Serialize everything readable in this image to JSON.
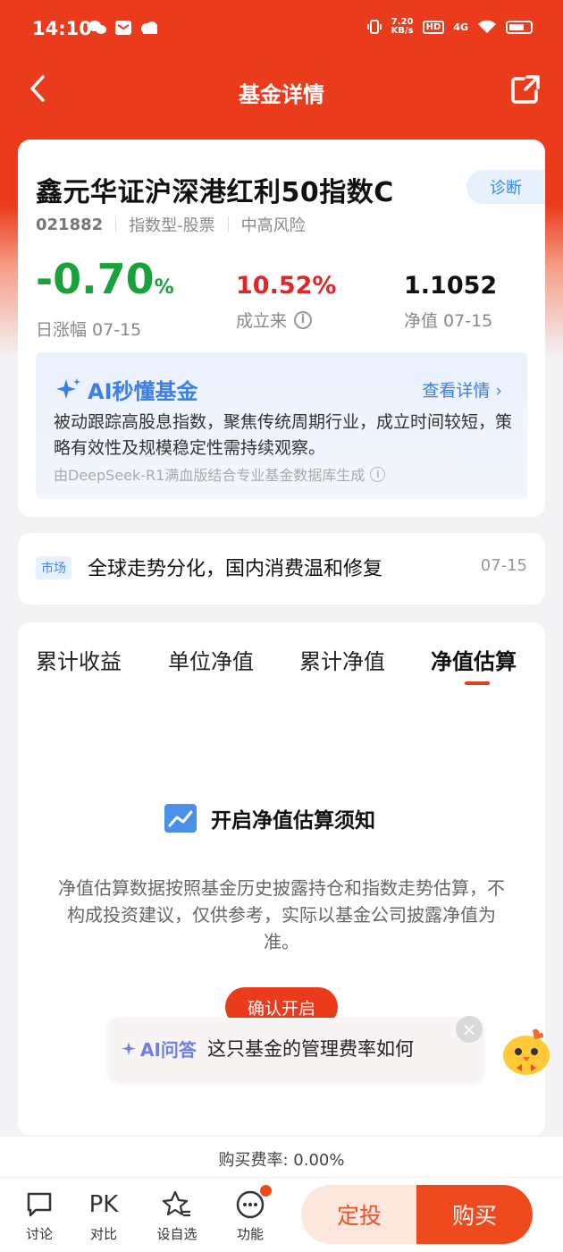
{
  "colors": {
    "brand": "#ea3c1d",
    "down": "#1aa23a",
    "up": "#e3242b",
    "link": "#3a7ee6"
  },
  "status": {
    "time": "14:10",
    "speed": "7.20",
    "speed_unit": "KB/s",
    "hd": "HD",
    "net": "4G"
  },
  "nav": {
    "title": "基金详情"
  },
  "fund": {
    "name": "鑫元华证沪深港红利50指数C",
    "diagnose": "诊断",
    "code": "021882",
    "type": "指数型-股票",
    "risk": "中高风险",
    "daily_change": "-0.70",
    "daily_change_unit": "%",
    "daily_label": "日涨幅 07-15",
    "since_inception": "10.52%",
    "since_label": "成立来",
    "nav_value": "1.1052",
    "nav_label": "净值 07-15"
  },
  "ai_summary": {
    "title": "AI秒懂基金",
    "more": "查看详情",
    "text": "被动跟踪高股息指数，聚焦传统周期行业，成立时间较短，策略有效性及规模稳定性需持续观察。",
    "source": "由DeepSeek-R1满血版结合专业基金数据库生成"
  },
  "news": {
    "tag": "市场",
    "text": "全球走势分化，国内消费温和修复",
    "date": "07-15"
  },
  "tabs": [
    "累计收益",
    "单位净值",
    "累计净值",
    "净值估算"
  ],
  "estimate": {
    "title": "开启净值估算须知",
    "desc": "净值估算数据按照基金历史披露持仓和指数走势估算，不构成投资建议，仅供参考，实际以基金公司披露净值为准。",
    "confirm": "确认开启"
  },
  "ai_bubble": {
    "badge": "AI问答",
    "question": "这只基金的管理费率如何"
  },
  "fee": {
    "text": "购买费率: 0.00%"
  },
  "bottom": {
    "items": [
      {
        "label": "讨论",
        "icon": "chat-icon"
      },
      {
        "label": "对比",
        "icon": "pk-icon",
        "icon_text": "PK"
      },
      {
        "label": "设自选",
        "icon": "star-list-icon"
      },
      {
        "label": "功能",
        "icon": "more-icon"
      }
    ],
    "dingtou": "定投",
    "buy": "购买"
  }
}
